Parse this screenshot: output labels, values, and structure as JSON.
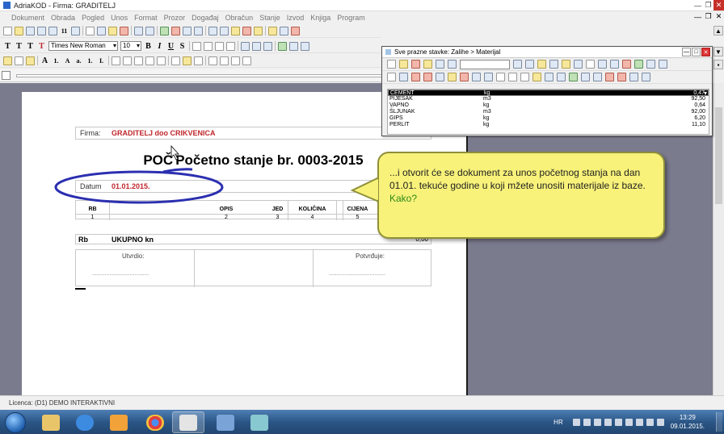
{
  "window": {
    "title": "AdriaKOD - Firma: GRADITELJ"
  },
  "menu": [
    "Dokument",
    "Obrada",
    "Pogled",
    "Unos",
    "Format",
    "Prozor",
    "Događaj",
    "Obračun",
    "Stanje",
    "Izvod",
    "Knjiga",
    "Program"
  ],
  "toolbar": {
    "font_name": "Times New Roman",
    "font_size": "10",
    "text_style_buttons": [
      "T",
      "T",
      "T",
      "T"
    ],
    "bold": "B",
    "italic": "I",
    "underline": "U",
    "strike": "S",
    "num_label": "11"
  },
  "document": {
    "firma_label": "Firma:",
    "firma_value": "GRADITELJ doo CRIKVENICA",
    "title_prefix": "POČ",
    "title": "Početno stanje br. 0003-2015",
    "datum_label": "Datum",
    "datum_value": "01.01.2015.",
    "columns": [
      {
        "header": "RB",
        "num": "1"
      },
      {
        "header": "OPIS",
        "num": "2"
      },
      {
        "header": "JED",
        "num": "3"
      },
      {
        "header": "KOLIČINA",
        "num": "4"
      },
      {
        "header": "CIJENA",
        "num": "5"
      }
    ],
    "sum_rb": "Rb",
    "sum_label": "UKUPNO kn",
    "sum_value": "0,00",
    "utvrdio": "Utvrdio:",
    "potvrdjuje": "Potvrđuje:",
    "dots": "...................................."
  },
  "popup": {
    "title": "Sve prazne stavke:  Zalihe > Materijal",
    "items": [
      {
        "name": "CEMENT",
        "unit": "kg",
        "price": "0,47",
        "selected": true
      },
      {
        "name": "PIJESAK",
        "unit": "m3",
        "price": "92,50",
        "selected": false
      },
      {
        "name": "VAPNO",
        "unit": "kg",
        "price": "0,64",
        "selected": false
      },
      {
        "name": "ŠLJUNAK",
        "unit": "m3",
        "price": "92,00",
        "selected": false
      },
      {
        "name": "GIPS",
        "unit": "kg",
        "price": "6,20",
        "selected": false
      },
      {
        "name": "PERLIT",
        "unit": "kg",
        "price": "11,10",
        "selected": false
      }
    ]
  },
  "tooltip": {
    "text": "...i otvorit će se dokument za unos početnog stanja na dan 01.01. tekuće godine u koji mžete unositi materijale iz baze.",
    "kako": "Kako?"
  },
  "status": {
    "licence": "Licenca:  (D1) DEMO INTERAKTIVNI"
  },
  "tray": {
    "lang": "HR",
    "time": "13:29",
    "date": "09.01.2015."
  },
  "colors": {
    "accent_red": "#c0262b",
    "bubble": "#f8f27a",
    "kako_green": "#2f8a18",
    "ellipse_blue": "#2b2fb0"
  }
}
